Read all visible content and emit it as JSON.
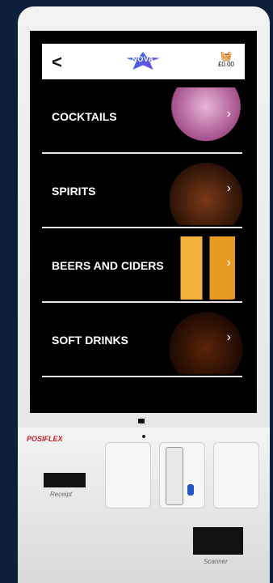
{
  "header": {
    "back_icon": "chevron-left-icon",
    "brand_name": "NOVA",
    "basket_total": "£0.00"
  },
  "menu": {
    "items": [
      {
        "label": "COCKTAILS"
      },
      {
        "label": "SPIRITS"
      },
      {
        "label": "BEERS AND CIDERS"
      },
      {
        "label": "SOFT DRINKS"
      }
    ]
  },
  "hardware": {
    "brand": "POSIFLEX",
    "receipt_label": "Receipt",
    "scanner_label": "Scanner"
  }
}
